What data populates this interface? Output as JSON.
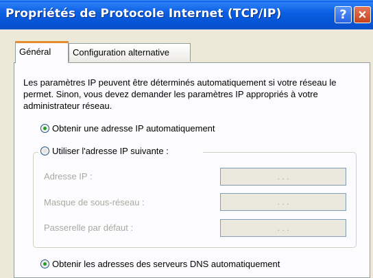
{
  "window": {
    "title": "Propriétés de Protocole Internet (TCP/IP)",
    "help_glyph": "?",
    "close_glyph": "✕"
  },
  "tabs": [
    {
      "label": "Général"
    },
    {
      "label": "Configuration alternative"
    }
  ],
  "description": "Les paramètres IP peuvent être déterminés automatiquement si votre réseau le permet. Sinon, vous devez demander les paramètres IP appropriés à votre administrateur réseau.",
  "ip_options": {
    "auto_label": "Obtenir une adresse IP automatiquement",
    "manual_label": "Utiliser l'adresse IP suivante :"
  },
  "fields": [
    {
      "label": "Adresse IP :",
      "value": ".   .   ."
    },
    {
      "label": "Masque de sous-réseau :",
      "value": ".   .   ."
    },
    {
      "label": "Passerelle par défaut :",
      "value": ".   .   ."
    }
  ],
  "dns_options": {
    "auto_label": "Obtenir les adresses des serveurs DNS automatiquement"
  }
}
